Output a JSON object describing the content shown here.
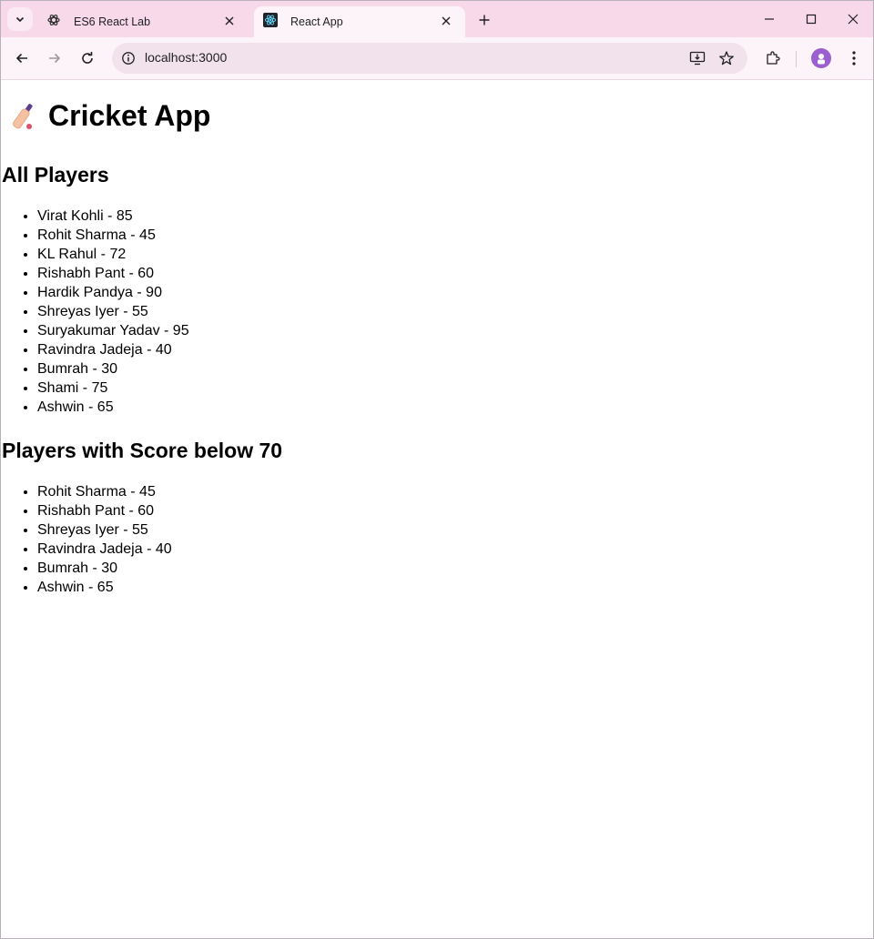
{
  "browser": {
    "tabs": [
      {
        "title": "ES6 React Lab",
        "active": false,
        "favicon": "chatgpt-icon"
      },
      {
        "title": "React App",
        "active": true,
        "favicon": "react-icon"
      }
    ],
    "address": "localhost:3000"
  },
  "page": {
    "title": "Cricket App",
    "title_icon": "cricket-bat-icon",
    "all_players_heading": "All Players",
    "all_players": [
      "Virat Kohli - 85",
      "Rohit Sharma - 45",
      "KL Rahul - 72",
      "Rishabh Pant - 60",
      "Hardik Pandya - 90",
      "Shreyas Iyer - 55",
      "Suryakumar Yadav - 95",
      "Ravindra Jadeja - 40",
      "Bumrah - 30",
      "Shami - 75",
      "Ashwin - 65"
    ],
    "below_heading": "Players with Score below 70",
    "below_players": [
      "Rohit Sharma - 45",
      "Rishabh Pant - 60",
      "Shreyas Iyer - 55",
      "Ravindra Jadeja - 40",
      "Bumrah - 30",
      "Ashwin - 65"
    ]
  }
}
